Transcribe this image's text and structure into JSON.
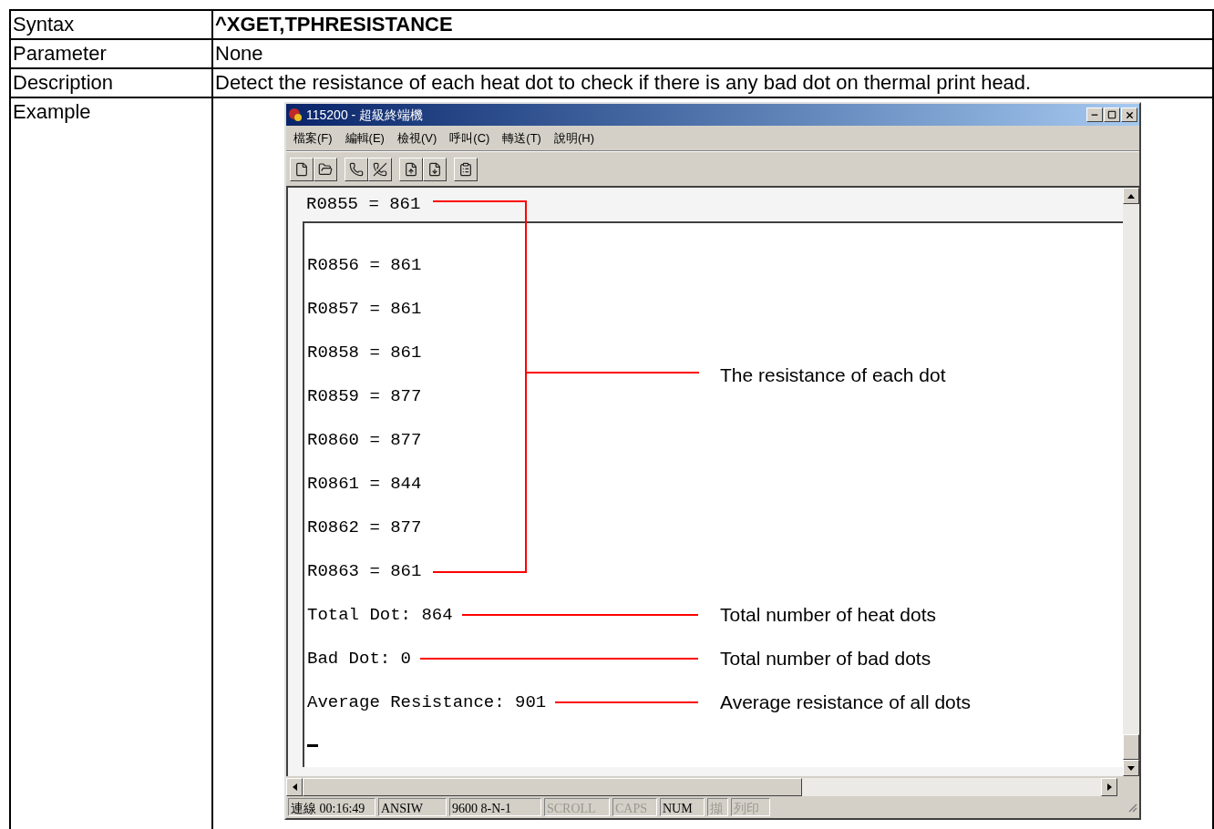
{
  "table": {
    "rows": [
      {
        "label": "Syntax",
        "value": "^XGET,TPHRESISTANCE",
        "bold": true
      },
      {
        "label": "Parameter",
        "value": "None",
        "bold": false
      },
      {
        "label": "Description",
        "value": "Detect the resistance of each heat dot to check if there is any bad dot on thermal print head.",
        "bold": false
      },
      {
        "label": "Example"
      }
    ]
  },
  "window": {
    "title": "115200 - 超級終端機",
    "menu": [
      "檔案(F)",
      "編輯(E)",
      "檢視(V)",
      "呼叫(C)",
      "轉送(T)",
      "說明(H)"
    ],
    "terminal": {
      "top_line": "R0855 = 861",
      "lines": [
        {
          "text": "R0856 = 861"
        },
        {
          "text": "R0857 = 861"
        },
        {
          "text": "R0858 = 861"
        },
        {
          "text": "R0859 = 877"
        },
        {
          "text": "R0860 = 877"
        },
        {
          "text": "R0861 = 844"
        },
        {
          "text": "R0862 = 877"
        },
        {
          "text": "R0863 = 861"
        },
        {
          "text": "Total Dot: 864",
          "note": "Total number of heat dots"
        },
        {
          "text": "Bad Dot: 0",
          "note": "Total number of bad dots"
        },
        {
          "text": "Average Resistance: 901",
          "note": "Average resistance of all dots"
        }
      ],
      "bracket_note": "The resistance of each dot"
    },
    "status_bar": [
      {
        "text": "連線 00:16:49",
        "disabled": false
      },
      {
        "text": "ANSIW",
        "disabled": false
      },
      {
        "text": "9600 8-N-1",
        "disabled": false
      },
      {
        "text": "SCROLL",
        "disabled": true
      },
      {
        "text": "CAPS",
        "disabled": true
      },
      {
        "text": "NUM",
        "disabled": false
      },
      {
        "text": "擷",
        "disabled": true
      },
      {
        "text": "列印",
        "disabled": true
      }
    ]
  }
}
